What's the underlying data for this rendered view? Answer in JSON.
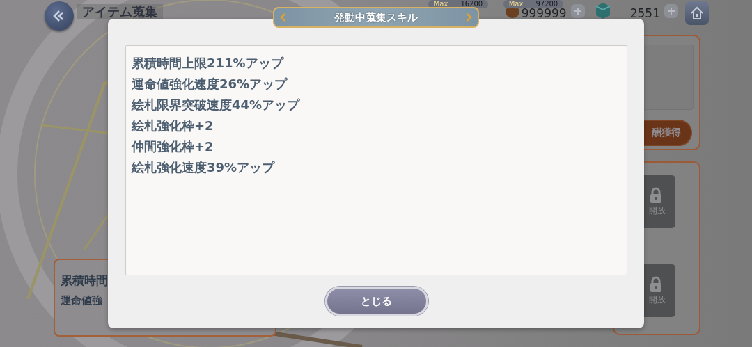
{
  "header": {
    "title": "アイテム蒐集"
  },
  "currencies": [
    {
      "kind": "max",
      "max_label": "Max",
      "max_value": "16200"
    },
    {
      "kind": "max",
      "max_label": "Max",
      "max_value": "97200",
      "amount": "999999"
    },
    {
      "kind": "plain",
      "amount": "2551"
    }
  ],
  "left_card": {
    "lines": [
      "累積時間",
      "運命値強"
    ]
  },
  "right_panel": {
    "reward_button": "酬獲得",
    "slots": [
      {
        "label": "開放",
        "locked": true
      },
      {
        "label": "開放",
        "locked": true
      }
    ]
  },
  "dialog": {
    "title": "発動中蒐集スキル",
    "skills": [
      "累積時間上限211%アップ",
      "運命値強化速度26%アップ",
      "絵札限界突破速度44%アップ",
      "絵札強化枠+2",
      "仲間強化枠+2",
      "絵札強化速度39%アップ"
    ],
    "close_button": "とじる"
  }
}
